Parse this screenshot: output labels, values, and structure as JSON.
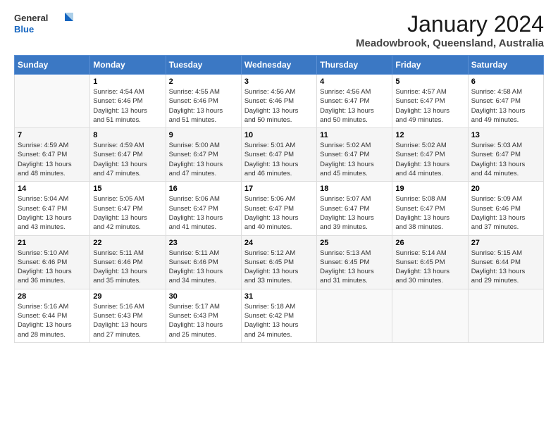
{
  "logo": {
    "line1": "General",
    "line2": "Blue"
  },
  "title": "January 2024",
  "location": "Meadowbrook, Queensland, Australia",
  "weekdays": [
    "Sunday",
    "Monday",
    "Tuesday",
    "Wednesday",
    "Thursday",
    "Friday",
    "Saturday"
  ],
  "weeks": [
    [
      {
        "day": "",
        "text": ""
      },
      {
        "day": "1",
        "text": "Sunrise: 4:54 AM\nSunset: 6:46 PM\nDaylight: 13 hours\nand 51 minutes."
      },
      {
        "day": "2",
        "text": "Sunrise: 4:55 AM\nSunset: 6:46 PM\nDaylight: 13 hours\nand 51 minutes."
      },
      {
        "day": "3",
        "text": "Sunrise: 4:56 AM\nSunset: 6:46 PM\nDaylight: 13 hours\nand 50 minutes."
      },
      {
        "day": "4",
        "text": "Sunrise: 4:56 AM\nSunset: 6:47 PM\nDaylight: 13 hours\nand 50 minutes."
      },
      {
        "day": "5",
        "text": "Sunrise: 4:57 AM\nSunset: 6:47 PM\nDaylight: 13 hours\nand 49 minutes."
      },
      {
        "day": "6",
        "text": "Sunrise: 4:58 AM\nSunset: 6:47 PM\nDaylight: 13 hours\nand 49 minutes."
      }
    ],
    [
      {
        "day": "7",
        "text": "Sunrise: 4:59 AM\nSunset: 6:47 PM\nDaylight: 13 hours\nand 48 minutes."
      },
      {
        "day": "8",
        "text": "Sunrise: 4:59 AM\nSunset: 6:47 PM\nDaylight: 13 hours\nand 47 minutes."
      },
      {
        "day": "9",
        "text": "Sunrise: 5:00 AM\nSunset: 6:47 PM\nDaylight: 13 hours\nand 47 minutes."
      },
      {
        "day": "10",
        "text": "Sunrise: 5:01 AM\nSunset: 6:47 PM\nDaylight: 13 hours\nand 46 minutes."
      },
      {
        "day": "11",
        "text": "Sunrise: 5:02 AM\nSunset: 6:47 PM\nDaylight: 13 hours\nand 45 minutes."
      },
      {
        "day": "12",
        "text": "Sunrise: 5:02 AM\nSunset: 6:47 PM\nDaylight: 13 hours\nand 44 minutes."
      },
      {
        "day": "13",
        "text": "Sunrise: 5:03 AM\nSunset: 6:47 PM\nDaylight: 13 hours\nand 44 minutes."
      }
    ],
    [
      {
        "day": "14",
        "text": "Sunrise: 5:04 AM\nSunset: 6:47 PM\nDaylight: 13 hours\nand 43 minutes."
      },
      {
        "day": "15",
        "text": "Sunrise: 5:05 AM\nSunset: 6:47 PM\nDaylight: 13 hours\nand 42 minutes."
      },
      {
        "day": "16",
        "text": "Sunrise: 5:06 AM\nSunset: 6:47 PM\nDaylight: 13 hours\nand 41 minutes."
      },
      {
        "day": "17",
        "text": "Sunrise: 5:06 AM\nSunset: 6:47 PM\nDaylight: 13 hours\nand 40 minutes."
      },
      {
        "day": "18",
        "text": "Sunrise: 5:07 AM\nSunset: 6:47 PM\nDaylight: 13 hours\nand 39 minutes."
      },
      {
        "day": "19",
        "text": "Sunrise: 5:08 AM\nSunset: 6:47 PM\nDaylight: 13 hours\nand 38 minutes."
      },
      {
        "day": "20",
        "text": "Sunrise: 5:09 AM\nSunset: 6:46 PM\nDaylight: 13 hours\nand 37 minutes."
      }
    ],
    [
      {
        "day": "21",
        "text": "Sunrise: 5:10 AM\nSunset: 6:46 PM\nDaylight: 13 hours\nand 36 minutes."
      },
      {
        "day": "22",
        "text": "Sunrise: 5:11 AM\nSunset: 6:46 PM\nDaylight: 13 hours\nand 35 minutes."
      },
      {
        "day": "23",
        "text": "Sunrise: 5:11 AM\nSunset: 6:46 PM\nDaylight: 13 hours\nand 34 minutes."
      },
      {
        "day": "24",
        "text": "Sunrise: 5:12 AM\nSunset: 6:45 PM\nDaylight: 13 hours\nand 33 minutes."
      },
      {
        "day": "25",
        "text": "Sunrise: 5:13 AM\nSunset: 6:45 PM\nDaylight: 13 hours\nand 31 minutes."
      },
      {
        "day": "26",
        "text": "Sunrise: 5:14 AM\nSunset: 6:45 PM\nDaylight: 13 hours\nand 30 minutes."
      },
      {
        "day": "27",
        "text": "Sunrise: 5:15 AM\nSunset: 6:44 PM\nDaylight: 13 hours\nand 29 minutes."
      }
    ],
    [
      {
        "day": "28",
        "text": "Sunrise: 5:16 AM\nSunset: 6:44 PM\nDaylight: 13 hours\nand 28 minutes."
      },
      {
        "day": "29",
        "text": "Sunrise: 5:16 AM\nSunset: 6:43 PM\nDaylight: 13 hours\nand 27 minutes."
      },
      {
        "day": "30",
        "text": "Sunrise: 5:17 AM\nSunset: 6:43 PM\nDaylight: 13 hours\nand 25 minutes."
      },
      {
        "day": "31",
        "text": "Sunrise: 5:18 AM\nSunset: 6:42 PM\nDaylight: 13 hours\nand 24 minutes."
      },
      {
        "day": "",
        "text": ""
      },
      {
        "day": "",
        "text": ""
      },
      {
        "day": "",
        "text": ""
      }
    ]
  ]
}
